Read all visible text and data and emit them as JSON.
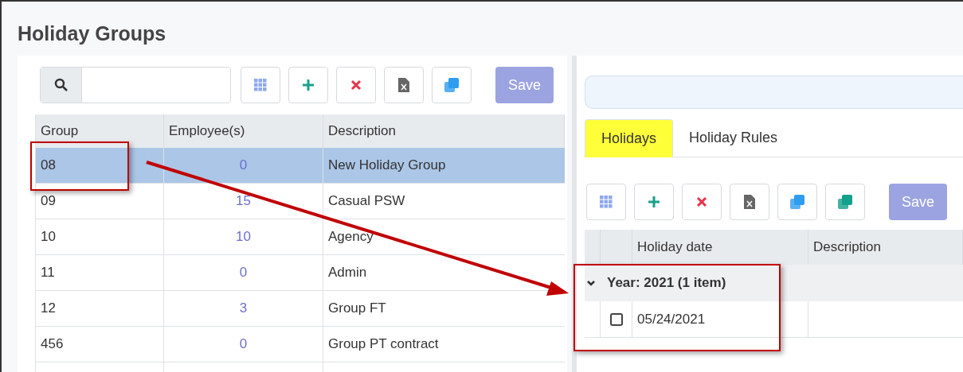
{
  "title": "Holiday Groups",
  "groups": {
    "toolbar": [
      {
        "kind": "columns"
      },
      {
        "kind": "add"
      },
      {
        "kind": "delete"
      },
      {
        "kind": "excel"
      },
      {
        "kind": "copy"
      },
      {
        "kind": "save",
        "label": "Save",
        "disabled": true
      }
    ],
    "columns": [
      "Group",
      "Employee(s)",
      "Description"
    ],
    "rows": [
      {
        "group": "08",
        "employees": "0",
        "description": "New Holiday Group",
        "selected": true
      },
      {
        "group": "09",
        "employees": "15",
        "description": "Casual PSW",
        "selected": false
      },
      {
        "group": "10",
        "employees": "10",
        "description": "Agency",
        "selected": false
      },
      {
        "group": "11",
        "employees": "0",
        "description": "Admin",
        "selected": false
      },
      {
        "group": "12",
        "employees": "3",
        "description": "Group FT",
        "selected": false
      },
      {
        "group": "456",
        "employees": "0",
        "description": "Group PT contract",
        "selected": false
      }
    ]
  },
  "details": {
    "tabs": [
      {
        "label": "Holidays",
        "selected": true,
        "highlighted": true
      },
      {
        "label": "Holiday Rules",
        "selected": false,
        "highlighted": false
      }
    ],
    "toolbar": [
      {
        "kind": "columns"
      },
      {
        "kind": "add"
      },
      {
        "kind": "delete"
      },
      {
        "kind": "excel"
      },
      {
        "kind": "copy"
      },
      {
        "kind": "copy-alt"
      },
      {
        "kind": "save",
        "label": "Save",
        "disabled": true
      }
    ],
    "columns": [
      "Holiday date",
      "Description"
    ],
    "year_groups": [
      {
        "label": "Year: 2021 (1 item)",
        "expanded": true,
        "rows": [
          {
            "date": "05/24/2021",
            "checked": false
          }
        ]
      }
    ]
  }
}
